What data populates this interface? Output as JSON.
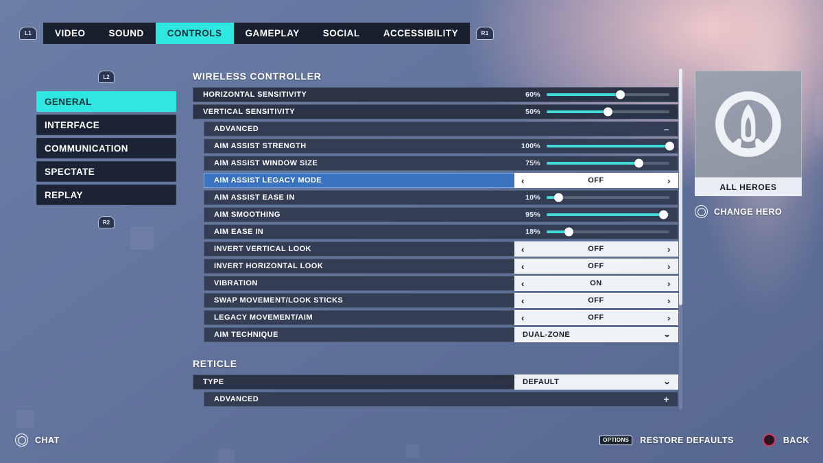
{
  "topnav": {
    "left_shoulder": "L1",
    "right_shoulder": "R1",
    "tabs": [
      {
        "label": "VIDEO",
        "active": false
      },
      {
        "label": "SOUND",
        "active": false
      },
      {
        "label": "CONTROLS",
        "active": true
      },
      {
        "label": "GAMEPLAY",
        "active": false
      },
      {
        "label": "SOCIAL",
        "active": false
      },
      {
        "label": "ACCESSIBILITY",
        "active": false
      }
    ]
  },
  "sidebar": {
    "hint_top": "L2",
    "hint_bottom": "R2",
    "items": [
      {
        "label": "GENERAL",
        "active": true
      },
      {
        "label": "INTERFACE",
        "active": false
      },
      {
        "label": "COMMUNICATION",
        "active": false
      },
      {
        "label": "SPECTATE",
        "active": false
      },
      {
        "label": "REPLAY",
        "active": false
      }
    ]
  },
  "panel": {
    "section1_title": "WIRELESS CONTROLLER",
    "section2_title": "RETICLE",
    "rows": {
      "horizontal_sensitivity": {
        "label": "HORIZONTAL SENSITIVITY",
        "value": "60%",
        "percent": 60
      },
      "vertical_sensitivity": {
        "label": "VERTICAL SENSITIVITY",
        "value": "50%",
        "percent": 50
      },
      "advanced_controller": {
        "label": "ADVANCED",
        "sign": "–"
      },
      "aim_assist_strength": {
        "label": "AIM ASSIST STRENGTH",
        "value": "100%",
        "percent": 100
      },
      "aim_assist_window_size": {
        "label": "AIM ASSIST WINDOW SIZE",
        "value": "75%",
        "percent": 75
      },
      "aim_assist_legacy_mode": {
        "label": "AIM ASSIST LEGACY MODE",
        "value": "OFF"
      },
      "aim_assist_ease_in": {
        "label": "AIM ASSIST EASE IN",
        "value": "10%",
        "percent": 10
      },
      "aim_smoothing": {
        "label": "AIM SMOOTHING",
        "value": "95%",
        "percent": 95
      },
      "aim_ease_in": {
        "label": "AIM EASE IN",
        "value": "18%",
        "percent": 18
      },
      "invert_vertical_look": {
        "label": "INVERT VERTICAL LOOK",
        "value": "OFF"
      },
      "invert_horizontal_look": {
        "label": "INVERT HORIZONTAL LOOK",
        "value": "OFF"
      },
      "vibration": {
        "label": "VIBRATION",
        "value": "ON"
      },
      "swap_movement_look_sticks": {
        "label": "SWAP MOVEMENT/LOOK STICKS",
        "value": "OFF"
      },
      "legacy_movement_aim": {
        "label": "LEGACY MOVEMENT/AIM",
        "value": "OFF"
      },
      "aim_technique": {
        "label": "AIM TECHNIQUE",
        "value": "DUAL-ZONE"
      },
      "reticle_type": {
        "label": "TYPE",
        "value": "DEFAULT"
      },
      "reticle_advanced": {
        "label": "ADVANCED",
        "sign": "+"
      }
    },
    "stepper_left_arrow": "‹",
    "stepper_right_arrow": "›",
    "dropdown_caret": "⌄"
  },
  "hero": {
    "name": "ALL HEROES",
    "change_label": "CHANGE HERO",
    "change_button_icon": "r3-stick-icon"
  },
  "footer": {
    "chat_label": "CHAT",
    "chat_button_icon": "l3-stick-icon",
    "restore_label": "RESTORE DEFAULTS",
    "restore_button": "OPTIONS",
    "back_label": "BACK",
    "back_button_icon": "circle-button-icon"
  },
  "colors": {
    "accent_cyan": "#30e8e2",
    "selected_blue": "#3a74c0",
    "panel_dark": "#2b3447",
    "background_blue": "#64759e"
  }
}
